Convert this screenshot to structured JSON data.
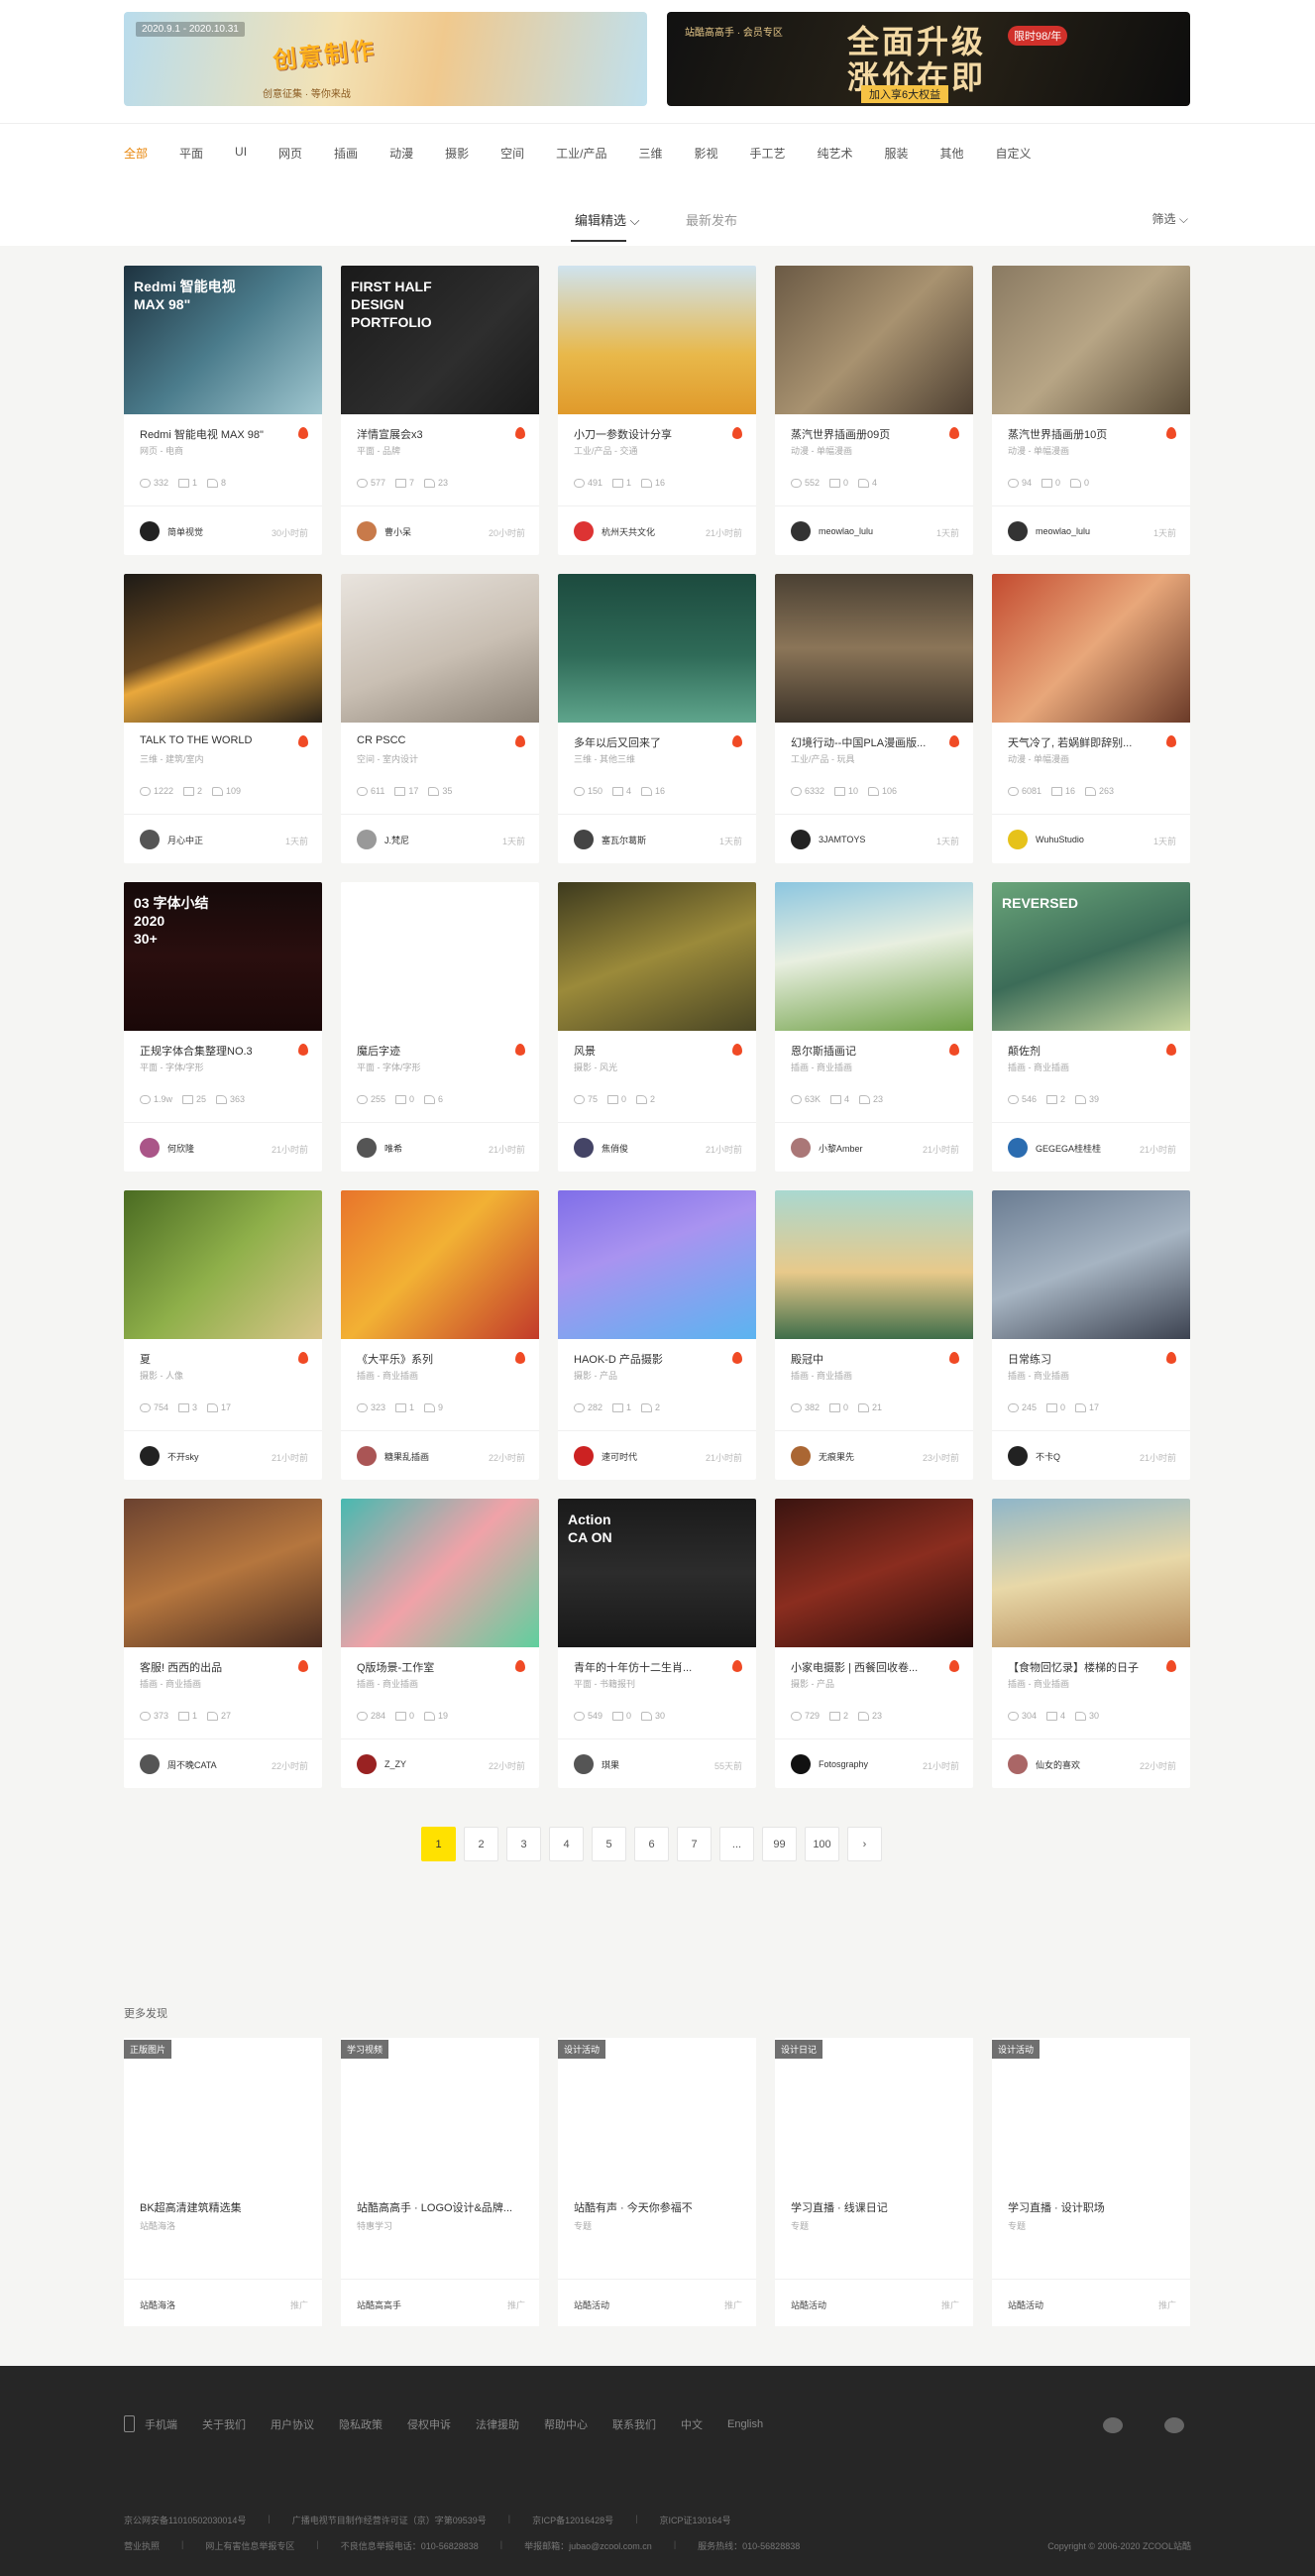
{
  "banners": {
    "left": {
      "label": "2020.9.1 - 2020.10.31",
      "headline": "创意制作",
      "sub": "创意征集 · 等你来战"
    },
    "right": {
      "label": "站酷高高手 · 会员专区",
      "headline_1": "全面升级",
      "headline_2": "涨价在即",
      "badge": "限时98/年",
      "cta": "加入享6大权益"
    }
  },
  "categories": [
    "全部",
    "平面",
    "UI",
    "网页",
    "插画",
    "动漫",
    "摄影",
    "空间",
    "工业/产品",
    "三维",
    "影视",
    "手工艺",
    "纯艺术",
    "服装",
    "其他",
    "自定义"
  ],
  "sort": {
    "tab1": "编辑精选",
    "tab2": "最新发布",
    "filter": "筛选"
  },
  "cards": [
    {
      "title": "Redmi 智能电视 MAX 98\"",
      "sub": "网页 - 电商",
      "views": "332",
      "comments": "1",
      "likes": "8",
      "author": "简单视觉",
      "ago": "30小时前",
      "thumb_text": "Redmi 智能电视\nMAX 98\"",
      "bg": "linear-gradient(135deg,#1e3340,#4b7c8c 50%,#9fc6cf)",
      "avatar": "#222"
    },
    {
      "title": "洋情宣展会x3",
      "sub": "平面 - 品牌",
      "views": "577",
      "comments": "7",
      "likes": "23",
      "author": "曹小呆",
      "ago": "20小时前",
      "thumb_text": "FIRST HALF\nDESIGN\nPORTFOLIO",
      "bg": "linear-gradient(135deg,#1a1a1a,#2e2e2e 60%,#1a1a1a)",
      "avatar": "#c87a4a"
    },
    {
      "title": "小刀一参数设计分享",
      "sub": "工业/产品 - 交通",
      "views": "491",
      "comments": "1",
      "likes": "16",
      "author": "杭州天共文化",
      "ago": "21小时前",
      "thumb_text": "",
      "bg": "linear-gradient(180deg,#cfe3ef,#e8b84a 60%,#e09a2b)",
      "avatar": "#d33"
    },
    {
      "title": "蒸汽世界插画册09页",
      "sub": "动漫 - 单幅漫画",
      "views": "552",
      "comments": "0",
      "likes": "4",
      "author": "meowlao_lulu",
      "ago": "1天前",
      "thumb_text": "",
      "bg": "linear-gradient(135deg,#6b5a45,#a89270 50%,#4e4032)",
      "avatar": "#333"
    },
    {
      "title": "蒸汽世界插画册10页",
      "sub": "动漫 - 单幅漫画",
      "views": "94",
      "comments": "0",
      "likes": "0",
      "author": "meowlao_lulu",
      "ago": "1天前",
      "thumb_text": "",
      "bg": "linear-gradient(135deg,#8a7a62,#b7a585 50%,#5c4e3a)",
      "avatar": "#333"
    },
    {
      "title": "TALK TO THE WORLD",
      "sub": "三维 - 建筑/室内",
      "views": "1222",
      "comments": "2",
      "likes": "109",
      "author": "月心中正",
      "ago": "1天前",
      "thumb_text": "",
      "bg": "linear-gradient(160deg,#1d1a16,#6b4a22 45%,#e9a83c 55%,#2a2218)",
      "avatar": "#555"
    },
    {
      "title": "CR PSCC",
      "sub": "空间 - 室内设计",
      "views": "611",
      "comments": "17",
      "likes": "35",
      "author": "J.梵尼",
      "ago": "1天前",
      "thumb_text": "",
      "bg": "linear-gradient(160deg,#e9e4de,#c9bfb3 55%,#8c8276)",
      "avatar": "#999"
    },
    {
      "title": "多年以后又回来了",
      "sub": "三维 - 其他三维",
      "views": "150",
      "comments": "4",
      "likes": "16",
      "author": "塞瓦尔葛斯",
      "ago": "1天前",
      "thumb_text": "",
      "bg": "linear-gradient(180deg,#1c4a3e,#2f6b58 55%,#5fa58c)",
      "avatar": "#444"
    },
    {
      "title": "幻境行动--中国PLA漫画版...",
      "sub": "工业/产品 - 玩具",
      "views": "6332",
      "comments": "10",
      "likes": "106",
      "author": "3JAMTOYS",
      "ago": "1天前",
      "thumb_text": "",
      "bg": "linear-gradient(180deg,#4a4033,#8b7558 50%,#3c3329)",
      "avatar": "#222"
    },
    {
      "title": "天气冷了, 若娲鲜即辞别...",
      "sub": "动漫 - 单幅漫画",
      "views": "6081",
      "comments": "16",
      "likes": "263",
      "author": "WuhuStudio",
      "ago": "1天前",
      "thumb_text": "",
      "bg": "linear-gradient(135deg,#c34a2f,#e8a77a 50%,#6a3a28)",
      "avatar": "#e6c21a"
    },
    {
      "title": "正规字体合集整理NO.3",
      "sub": "平面 - 字体/字形",
      "views": "1.9w",
      "comments": "25",
      "likes": "363",
      "author": "何欣隆",
      "ago": "21小时前",
      "thumb_text": "03 字体小结\n2020\n30+",
      "bg": "linear-gradient(180deg,#150a0a,#2a0e0e 50%,#1a0808)",
      "avatar": "#a58"
    },
    {
      "title": "魔后字迹",
      "sub": "平面 - 字体/字形",
      "views": "255",
      "comments": "0",
      "likes": "6",
      "author": "唯希",
      "ago": "21小时前",
      "thumb_text": "",
      "bg": "#ffffff",
      "avatar": "#555"
    },
    {
      "title": "风景",
      "sub": "摄影 - 风光",
      "views": "75",
      "comments": "0",
      "likes": "2",
      "author": "焦俏俊",
      "ago": "21小时前",
      "thumb_text": "",
      "bg": "linear-gradient(160deg,#3d3a1e,#9b8a3a 50%,#4a4624)",
      "avatar": "#446"
    },
    {
      "title": "恩尔斯插画记",
      "sub": "插画 - 商业插画",
      "views": "63K",
      "comments": "4",
      "likes": "23",
      "author": "小黎Amber",
      "ago": "21小时前",
      "thumb_text": "",
      "bg": "linear-gradient(170deg,#8cc6e0,#e8efe0 45%,#6fa046)",
      "avatar": "#a77"
    },
    {
      "title": "颠佐剂",
      "sub": "插画 - 商业插画",
      "views": "546",
      "comments": "2",
      "likes": "39",
      "author": "GEGEGA桂桂桂",
      "ago": "21小时前",
      "thumb_text": "REVERSED",
      "bg": "linear-gradient(160deg,#6aa57a,#3c6c58 50%,#c8d7a0)",
      "avatar": "#2b6cb0"
    },
    {
      "title": "夏",
      "sub": "摄影 - 人像",
      "views": "754",
      "comments": "3",
      "likes": "17",
      "author": "不开sky",
      "ago": "21小时前",
      "thumb_text": "",
      "bg": "linear-gradient(135deg,#4a6b22,#8fb04a 50%,#d9c58a)",
      "avatar": "#222"
    },
    {
      "title": "《大平乐》系列",
      "sub": "插画 - 商业插画",
      "views": "323",
      "comments": "1",
      "likes": "9",
      "author": "糖果乱插画",
      "ago": "22小时前",
      "thumb_text": "",
      "bg": "linear-gradient(135deg,#e8742b,#f2b134 45%,#c23a2a)",
      "avatar": "#a55"
    },
    {
      "title": "HAOK-D 产品摄影",
      "sub": "摄影 - 产品",
      "views": "282",
      "comments": "1",
      "likes": "2",
      "author": "速可时代",
      "ago": "21小时前",
      "thumb_text": "",
      "bg": "linear-gradient(160deg,#7f6ee8,#a993f0 40%,#5bb4f0)",
      "avatar": "#c22"
    },
    {
      "title": "殿冠中",
      "sub": "插画 - 商业插画",
      "views": "382",
      "comments": "0",
      "likes": "21",
      "author": "无痕果先",
      "ago": "23小时前",
      "thumb_text": "",
      "bg": "linear-gradient(180deg,#a9d8d0,#e8c98a 55%,#3f6e4a)",
      "avatar": "#a63"
    },
    {
      "title": "日常练习",
      "sub": "插画 - 商业插画",
      "views": "245",
      "comments": "0",
      "likes": "17",
      "author": "不卡Q",
      "ago": "21小时前",
      "thumb_text": "",
      "bg": "linear-gradient(160deg,#6a7c92,#a6b4c2 50%,#3c4250)",
      "avatar": "#222"
    },
    {
      "title": "客服! 西西的出品",
      "sub": "插画 - 商业插画",
      "views": "373",
      "comments": "1",
      "likes": "27",
      "author": "周不晚CATA",
      "ago": "22小时前",
      "thumb_text": "",
      "bg": "linear-gradient(160deg,#6b4230,#b5763e 50%,#4a2c20)",
      "avatar": "#555"
    },
    {
      "title": "Q版场景-工作室",
      "sub": "插画 - 商业插画",
      "views": "284",
      "comments": "0",
      "likes": "19",
      "author": "Z_ZY",
      "ago": "22小时前",
      "thumb_text": "",
      "bg": "linear-gradient(135deg,#47b9b0,#f0a2a8 50%,#5fcf9e)",
      "avatar": "#922"
    },
    {
      "title": "青年的十年仿十二生肖...",
      "sub": "平面 - 书籍报刊",
      "views": "549",
      "comments": "0",
      "likes": "30",
      "author": "琪果",
      "ago": "55天前",
      "thumb_text": "Action\nCA   ON",
      "bg": "linear-gradient(180deg,#1a1a1a,#2c2c2c 50%,#181818)",
      "avatar": "#555"
    },
    {
      "title": "小家电摄影 | 西餐回收卷...",
      "sub": "摄影 - 产品",
      "views": "729",
      "comments": "2",
      "likes": "23",
      "author": "Fotosgraphy",
      "ago": "21小时前",
      "thumb_text": "",
      "bg": "linear-gradient(160deg,#3a1410,#8a2d1f 50%,#2a0c0a)",
      "avatar": "#111"
    },
    {
      "title": "【食物回忆录】楼梯的日子",
      "sub": "插画 - 商业插画",
      "views": "304",
      "comments": "4",
      "likes": "30",
      "author": "仙女的喜欢",
      "ago": "22小时前",
      "thumb_text": "",
      "bg": "linear-gradient(170deg,#8fb6c9,#e8d8a8 50%,#b58a5a)",
      "avatar": "#a66"
    }
  ],
  "pagination": [
    "1",
    "2",
    "3",
    "4",
    "5",
    "6",
    "7",
    "...",
    "99",
    "100"
  ],
  "more_title": "更多发现",
  "more_cards": [
    {
      "tag": "正版图片",
      "title": "BK超高清建筑精选集",
      "sub": "站酷海洛",
      "foot": "站酷海洛",
      "ad": "推广"
    },
    {
      "tag": "学习视频",
      "title": "站酷高高手 · LOGO设计&品牌...",
      "sub": "特惠学习",
      "foot": "站酷高高手",
      "ad": "推广"
    },
    {
      "tag": "设计活动",
      "title": "站酷有声 · 今天你参福不",
      "sub": "专题",
      "foot": "站酷活动",
      "ad": "推广"
    },
    {
      "tag": "设计日记",
      "title": "学习直播 · 线课日记",
      "sub": "专题",
      "foot": "站酷活动",
      "ad": "推广"
    },
    {
      "tag": "设计活动",
      "title": "学习直播 · 设计职场",
      "sub": "专题",
      "foot": "站酷活动",
      "ad": "推广"
    }
  ],
  "footer": {
    "links": [
      "手机端",
      "关于我们",
      "用户协议",
      "隐私政策",
      "侵权申诉",
      "法律援助",
      "帮助中心",
      "联系我们",
      "中文",
      "English"
    ],
    "info1": [
      "京公网安备11010502030014号",
      "广播电视节目制作经营许可证（京）字第09539号",
      "京ICP备12016428号",
      "京ICP证130164号"
    ],
    "info2": [
      "营业执照",
      "网上有害信息举报专区",
      "不良信息举报电话：010-56828838",
      "举报邮箱：jubao@zcool.com.cn",
      "服务热线：010-56828838"
    ],
    "copyright": "Copyright © 2006-2020 ZCOOL站酷"
  },
  "colors": {
    "accent": "#e8860b",
    "pager_active": "#ffe100",
    "footer_bg": "#262626",
    "hot": "#f04a25"
  }
}
